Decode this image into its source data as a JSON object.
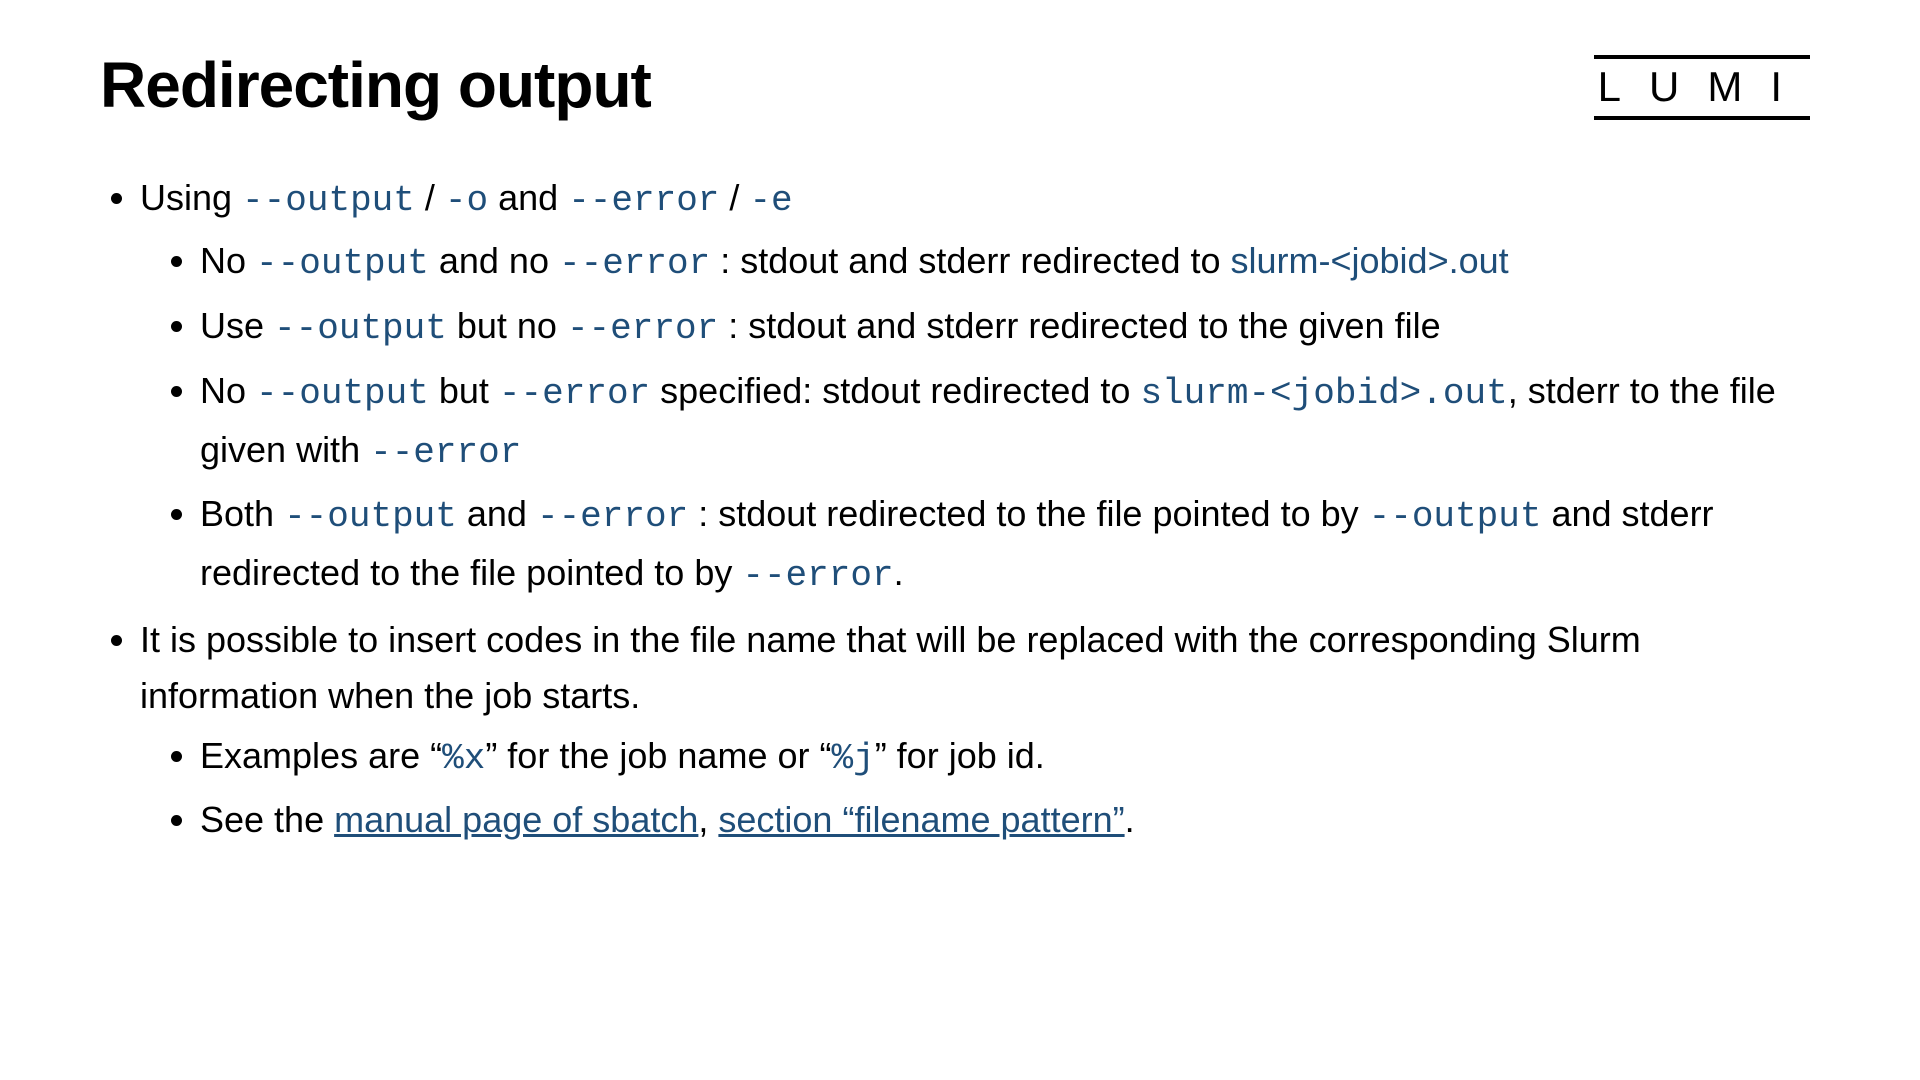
{
  "title": "Redirecting output",
  "logo": "LUMI",
  "flags": {
    "output_long": "--output",
    "output_short": "-o",
    "error_long": "--error",
    "error_short": "-e"
  },
  "filenames": {
    "slurm_out_text": "slurm-<jobid>.out",
    "slurm_out_code": "slurm-<jobid>.out"
  },
  "bullets": {
    "b1_prefix": "Using ",
    "b1_sep1": " / ",
    "b1_mid": " and ",
    "b1_sep2": " / ",
    "b1a_1": "No ",
    "b1a_2": " and no ",
    "b1a_3": " : stdout and stderr redirected to ",
    "b1b_1": "Use ",
    "b1b_2": " but no ",
    "b1b_3": " : stdout and stderr redirected to the given file",
    "b1c_1": "No ",
    "b1c_2": " but ",
    "b1c_3": " specified: stdout redirected to ",
    "b1c_4": ", stderr to the file given with ",
    "b1d_1": "Both ",
    "b1d_2": " and ",
    "b1d_3": " : stdout redirected to the file pointed to by ",
    "b1d_4": " and stderr redirected to the file pointed to by ",
    "b1d_5": ".",
    "b2": "It is possible to insert codes in the file name that will be replaced with the corresponding Slurm information when the job starts.",
    "b2a_1": "Examples are “",
    "b2a_code1": "%x",
    "b2a_2": "” for the job name or “",
    "b2a_code2": "%j",
    "b2a_3": "” for job id.",
    "b2b_1": "See the ",
    "b2b_link1": "manual page of sbatch",
    "b2b_2": ", ",
    "b2b_link2": "section “filename pattern”",
    "b2b_3": "."
  }
}
